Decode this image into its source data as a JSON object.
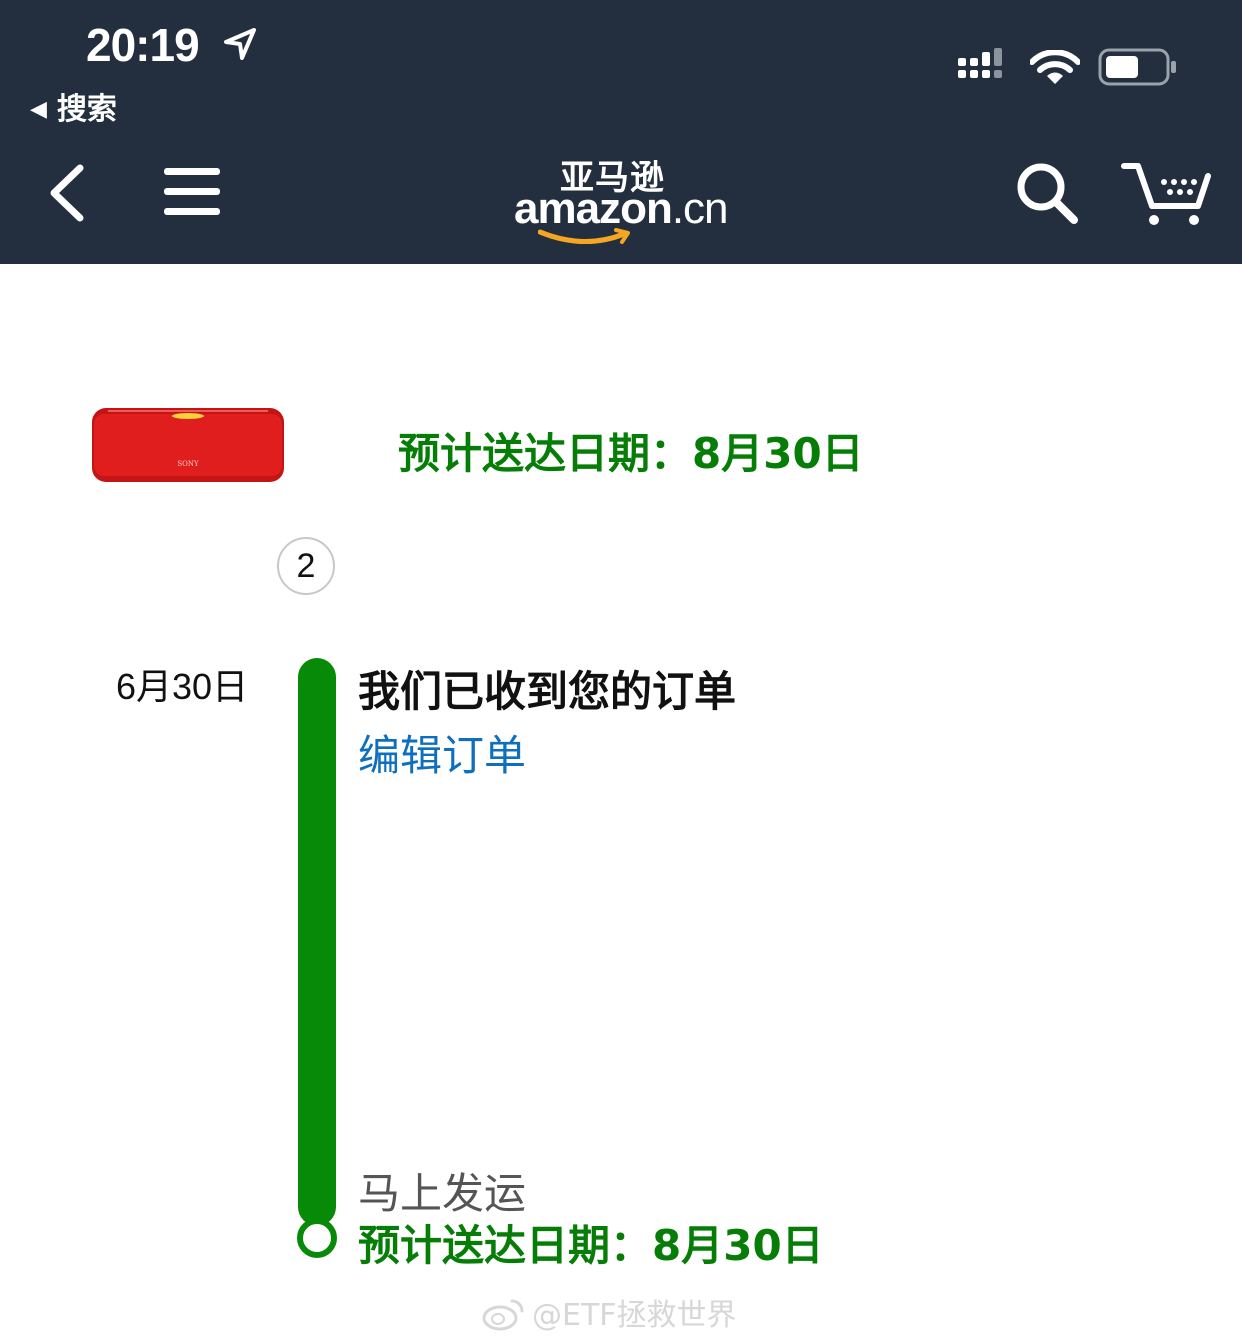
{
  "status_bar": {
    "time": "20:19",
    "back_label": "搜索"
  },
  "header": {
    "logo_cn": "亚马逊",
    "logo_en": "amazon",
    "logo_tld": ".cn"
  },
  "product": {
    "image": "red-sony-speaker",
    "quantity": "2"
  },
  "delivery": {
    "estimate_top": "预计送达日期：8月30日"
  },
  "timeline": {
    "date": "6月30日",
    "status_title": "我们已收到您的订单",
    "edit_link": "编辑订单",
    "ship_soon": "马上发运",
    "estimate": "预计送达日期：8月30日"
  },
  "watermark": "@ETF拯救世界",
  "colors": {
    "header_bg": "#232f3e",
    "green": "#067d06",
    "link": "#0f6fbf",
    "amazon_orange": "#f5a623"
  }
}
